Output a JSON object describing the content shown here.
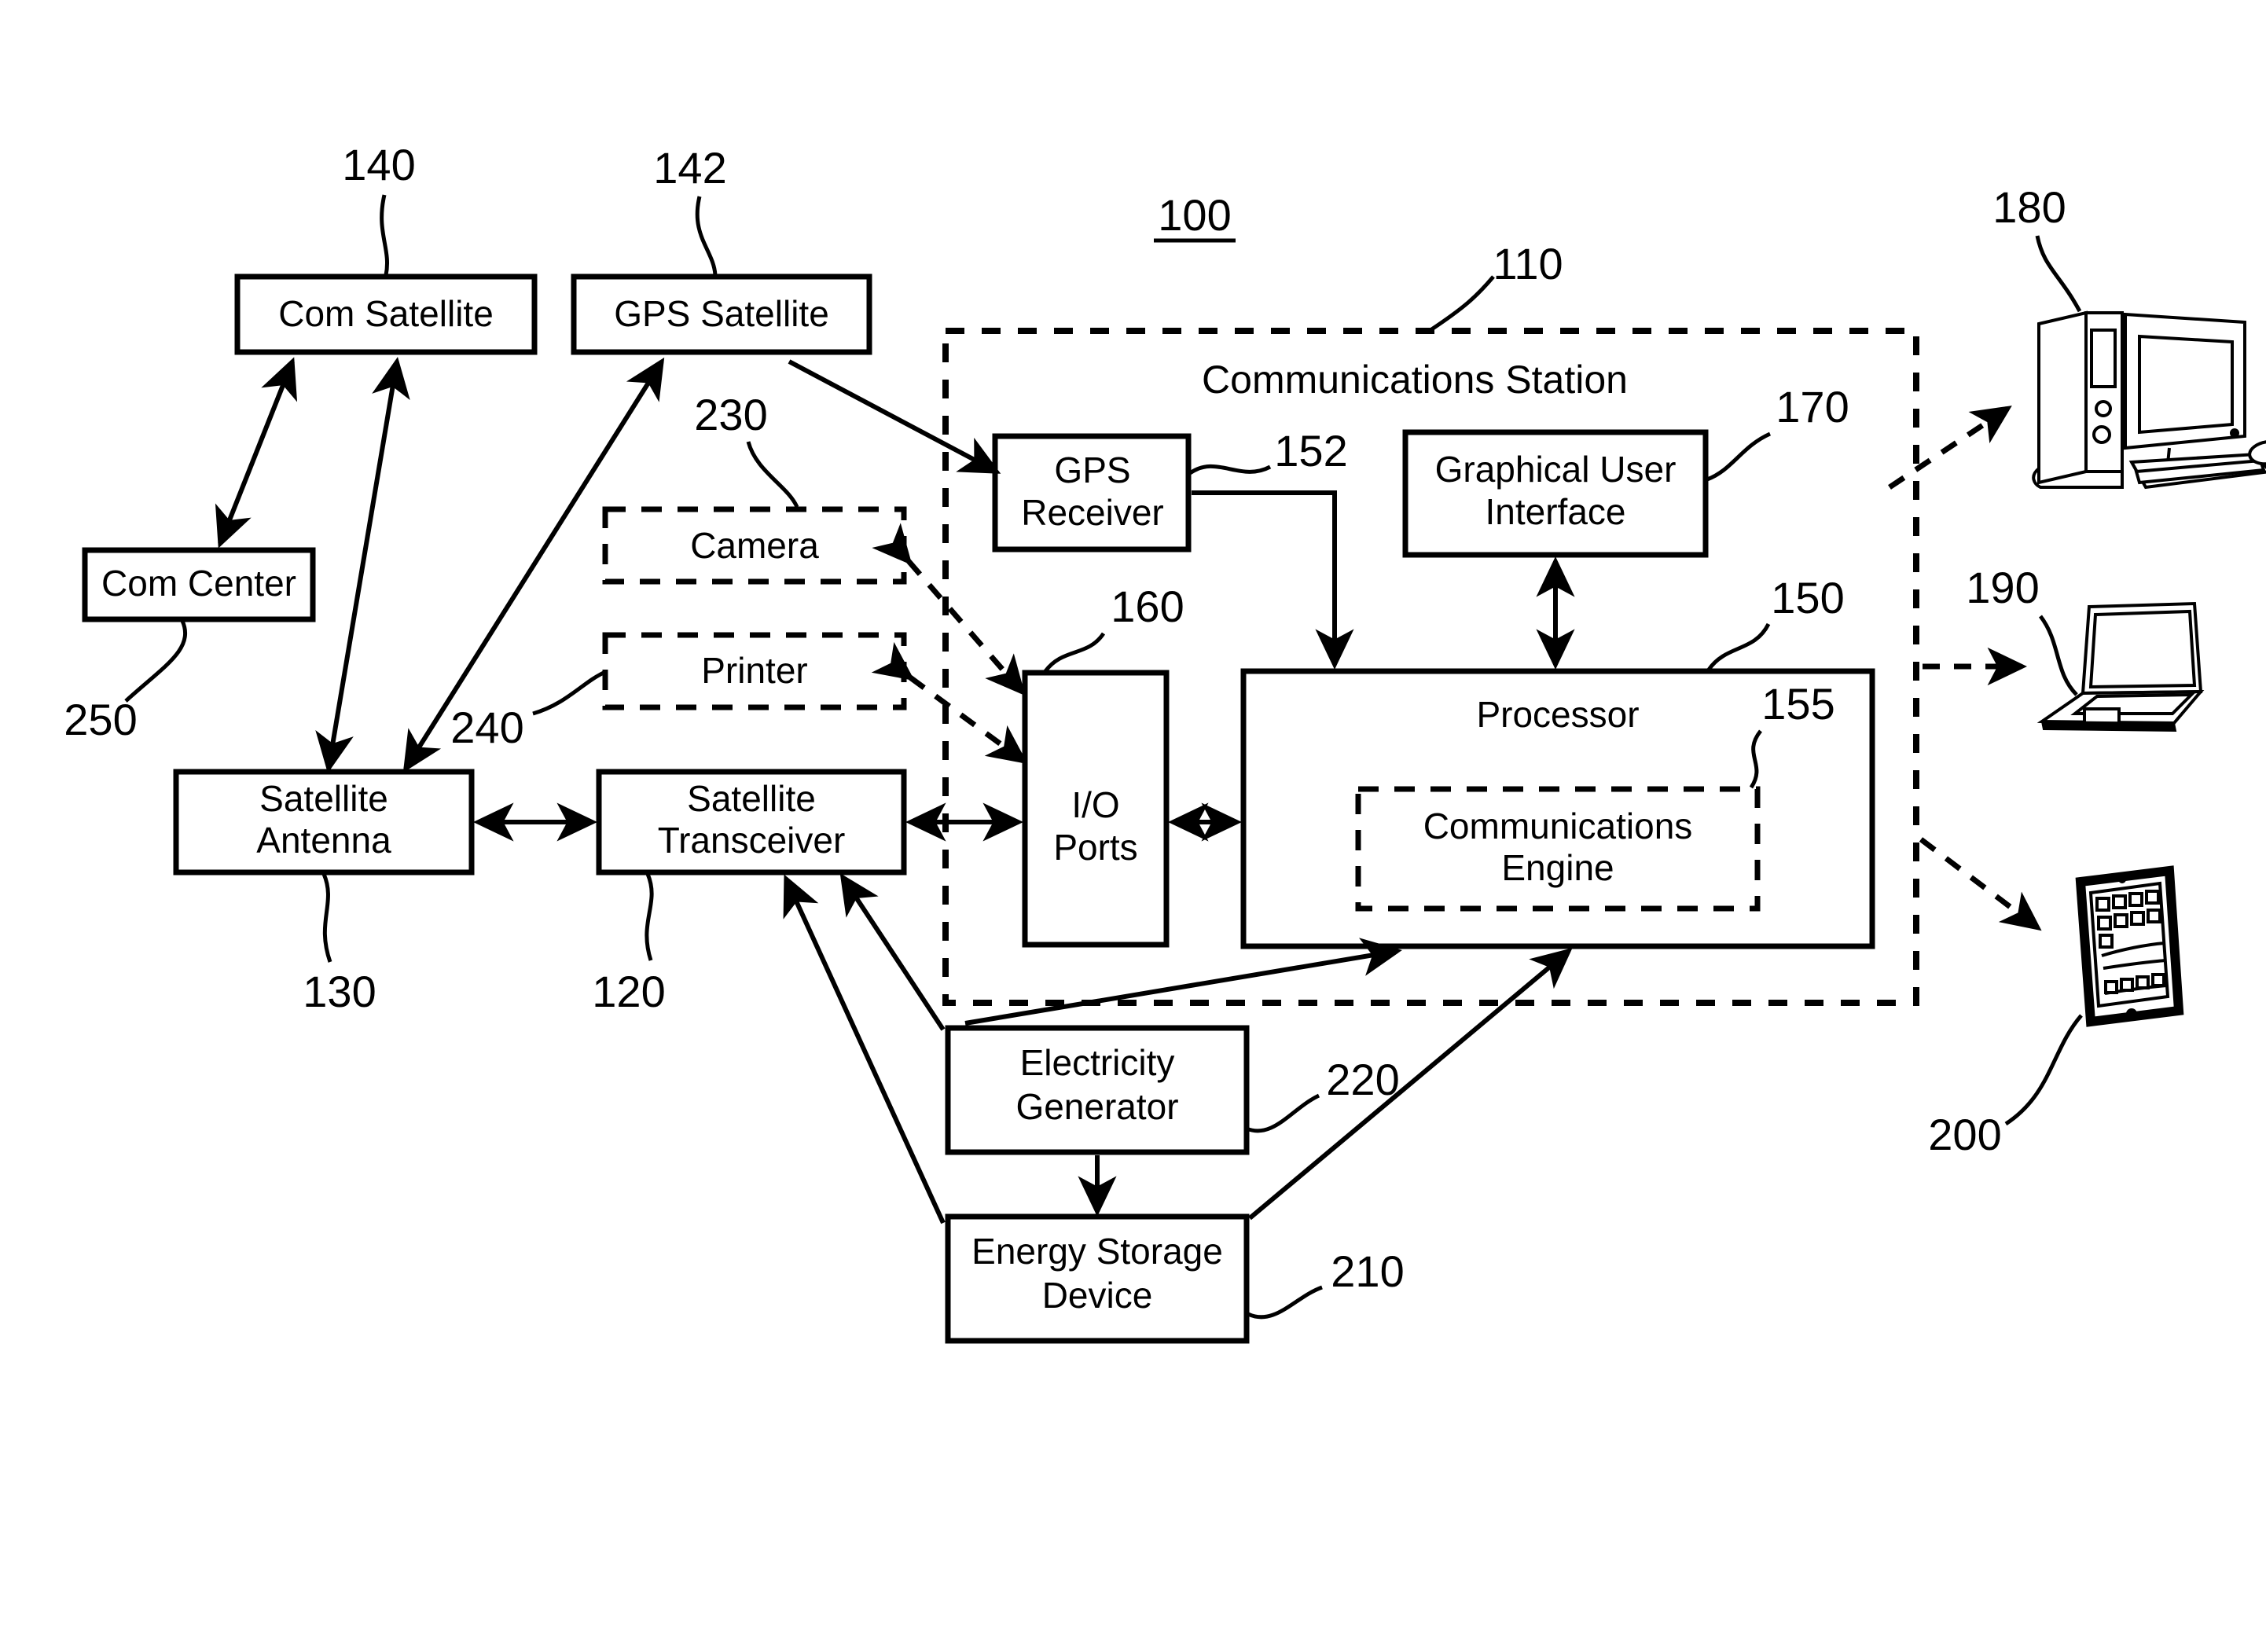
{
  "figure": {
    "title_ref": "100",
    "station": {
      "label": "Communications Station",
      "ref": "110"
    },
    "boxes": {
      "com_satellite": {
        "label": "Com Satellite",
        "ref": "140"
      },
      "gps_satellite": {
        "label": "GPS Satellite",
        "ref": "142"
      },
      "com_center": {
        "label": "Com Center",
        "ref": "250"
      },
      "camera": {
        "label": "Camera",
        "ref": "230"
      },
      "printer": {
        "label": "Printer",
        "ref": "240"
      },
      "satellite_antenna": {
        "label_line1": "Satellite",
        "label_line2": "Antenna",
        "ref": "130"
      },
      "satellite_transceiver": {
        "label_line1": "Satellite",
        "label_line2": "Transceiver",
        "ref": "120"
      },
      "gps_receiver": {
        "label_line1": "GPS",
        "label_line2": "Receiver",
        "ref": "152"
      },
      "io_ports": {
        "label_line1": "I/O",
        "label_line2": "Ports",
        "ref": "160"
      },
      "graphical_user_interface": {
        "label_line1": "Graphical User",
        "label_line2": "Interface",
        "ref": "170"
      },
      "processor": {
        "label": "Processor",
        "ref": "150"
      },
      "communications_engine": {
        "label_line1": "Communications",
        "label_line2": "Engine",
        "ref": "155"
      },
      "electricity_generator": {
        "label_line1": "Electricity",
        "label_line2": "Generator",
        "ref": "220"
      },
      "energy_storage_device": {
        "label_line1": "Energy Storage",
        "label_line2": "Device",
        "ref": "210"
      }
    },
    "devices": {
      "desktop_computer": {
        "ref": "180"
      },
      "laptop_computer": {
        "ref": "190"
      },
      "tablet_computer": {
        "ref": "200"
      }
    },
    "colors": {
      "ink": "#000000",
      "paper": "#ffffff"
    }
  }
}
